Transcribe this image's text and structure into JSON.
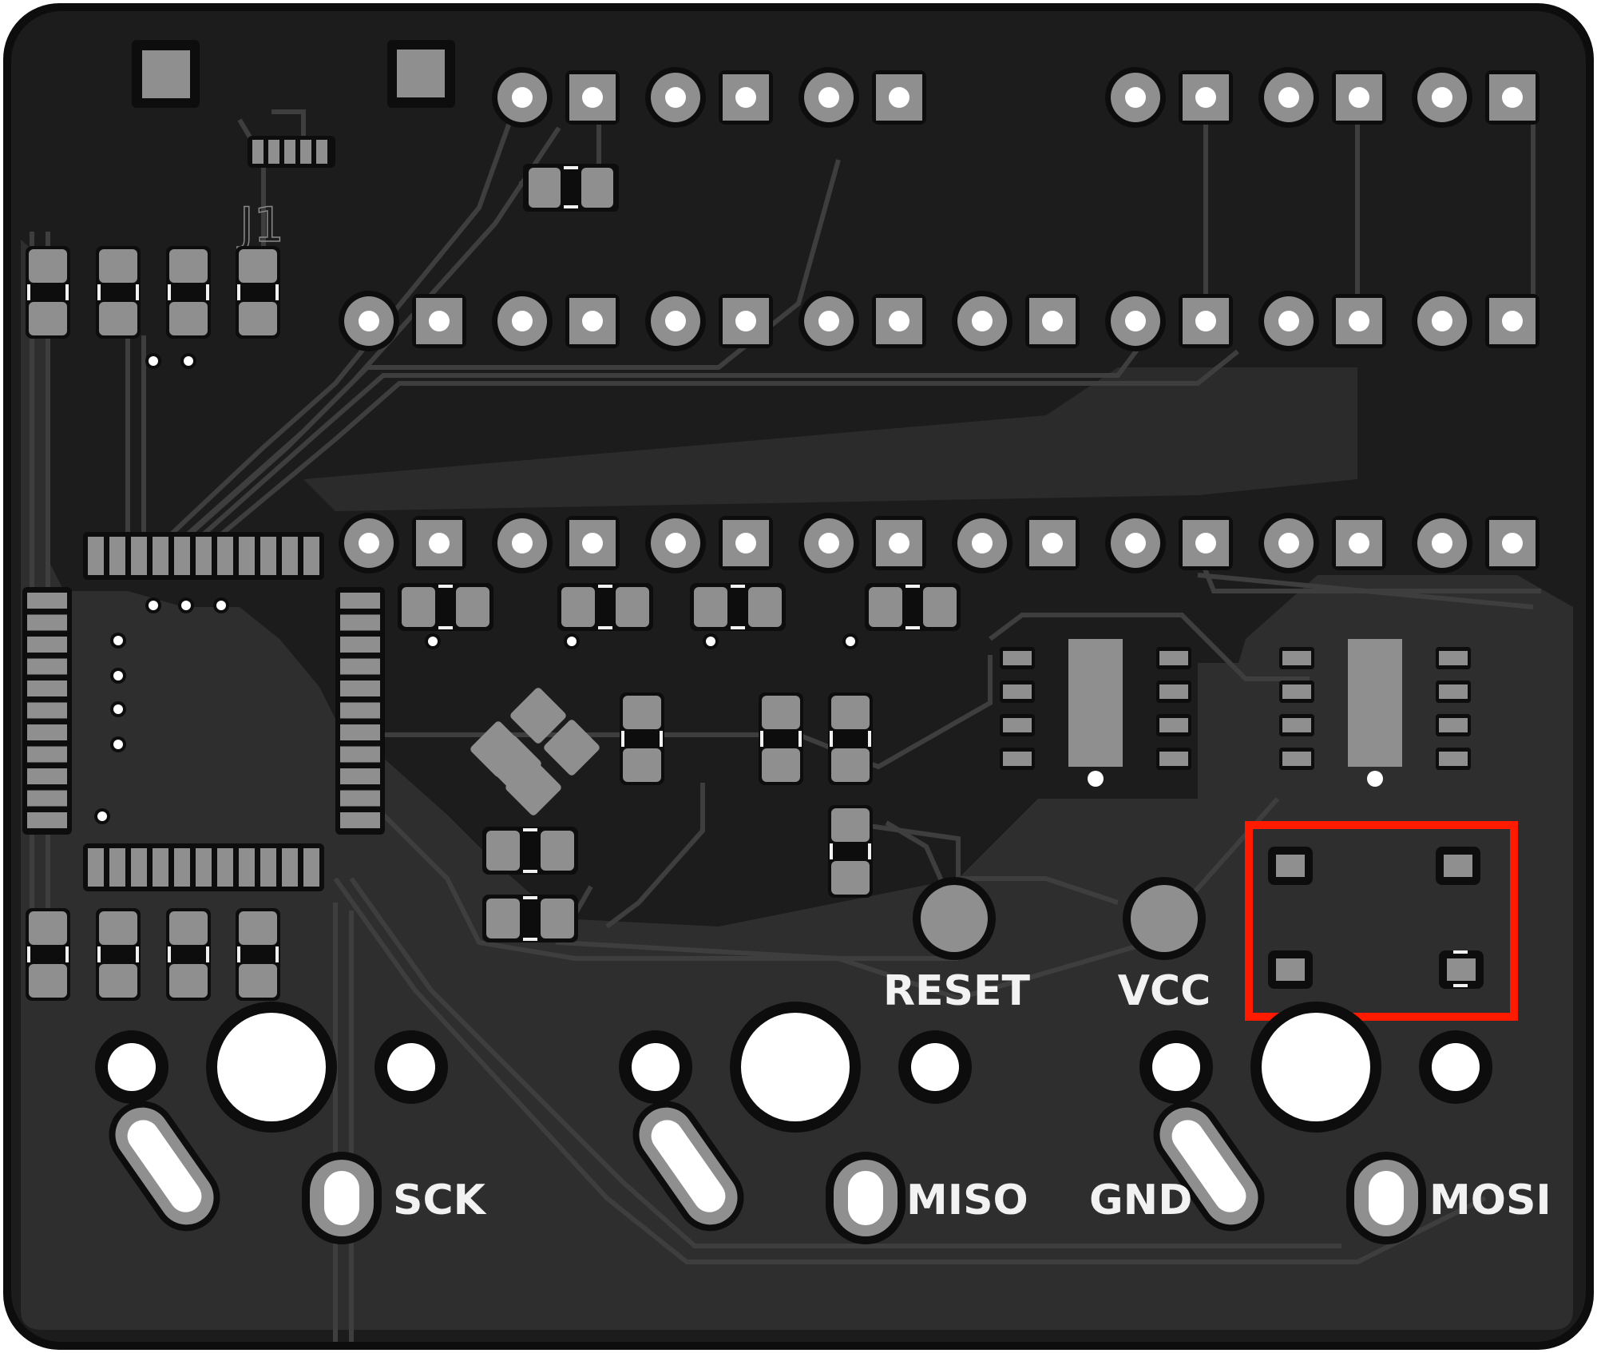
{
  "labels": {
    "reset": "RESET",
    "vcc": "VCC",
    "sck": "SCK",
    "miso": "MISO",
    "gnd": "GND",
    "mosi": "MOSI",
    "j1": "J1"
  },
  "colors": {
    "board": "#1c1c1c",
    "board_edge": "#0d0d0d",
    "copper_fill": "#2e2e2e",
    "pad": "#8f8f8f",
    "hole": "#ffffff",
    "silkscreen": "#f2f2f2",
    "highlight": "#ff1a00"
  }
}
